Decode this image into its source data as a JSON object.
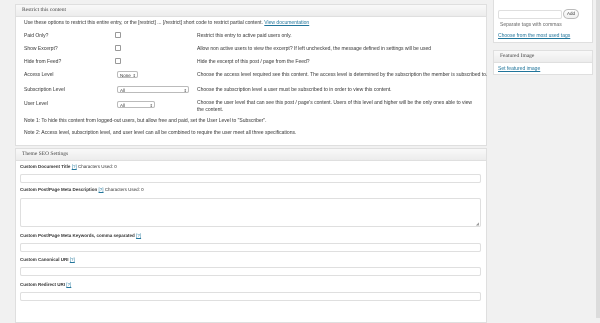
{
  "restrict": {
    "title": "Restrict this content",
    "intro": "Use these options to restrict this entire entry, or the [restrict] ... [/restrict] short code to restrict partial content.",
    "intro_link": "View documentation",
    "rows": [
      {
        "label": "Paid Only?",
        "desc": "Restrict this entry to active paid users only."
      },
      {
        "label": "Show Excerpt?",
        "desc": "Allow non active users to view the excerpt? If left unchecked, the message defined in settings will be used"
      },
      {
        "label": "Hide from Feed?",
        "desc": "Hide the excerpt of this post / page from the Feed?"
      },
      {
        "label": "Access Level",
        "value": "None",
        "desc": "Choose the access level required see this content. The access level is determined by the subscription the member is subscribed to."
      },
      {
        "label": "Subscription Level",
        "value": "All",
        "desc": "Choose the subscription level a user must be subscribed to in order to view this content."
      },
      {
        "label": "User Level",
        "value": "All",
        "desc": "Choose the user level that can see this post / page's content. Users of this level and higher will be the only ones able to view the content."
      }
    ],
    "note1": "Note 1: To hide this content from logged-out users, but allow free and paid, set the User Level to \"Subscriber\".",
    "note2": "Note 2: Access level, subscription level, and user level can all be combined to require the user meet all three specifications."
  },
  "seo": {
    "title": "Theme SEO Settings",
    "fields": [
      {
        "label": "Custom Document Title",
        "help": "[?]",
        "extra": "Characters Used: 0"
      },
      {
        "label": "Custom Post/Page Meta Description",
        "help": "[?]",
        "extra": "Characters Used: 0"
      },
      {
        "label": "Custom Post/Page Meta Keywords, comma separated",
        "help": "[?]",
        "extra": ""
      },
      {
        "label": "Custom Canonical URI",
        "help": "[?]",
        "extra": ""
      },
      {
        "label": "Custom Redirect URI",
        "help": "[?]",
        "extra": ""
      }
    ]
  },
  "tags": {
    "add_label": "Add",
    "hint": "Separate tags with commas",
    "choose_link": "Choose from the most used tags"
  },
  "featured": {
    "title": "Featured Image",
    "link": "Set featured image"
  }
}
